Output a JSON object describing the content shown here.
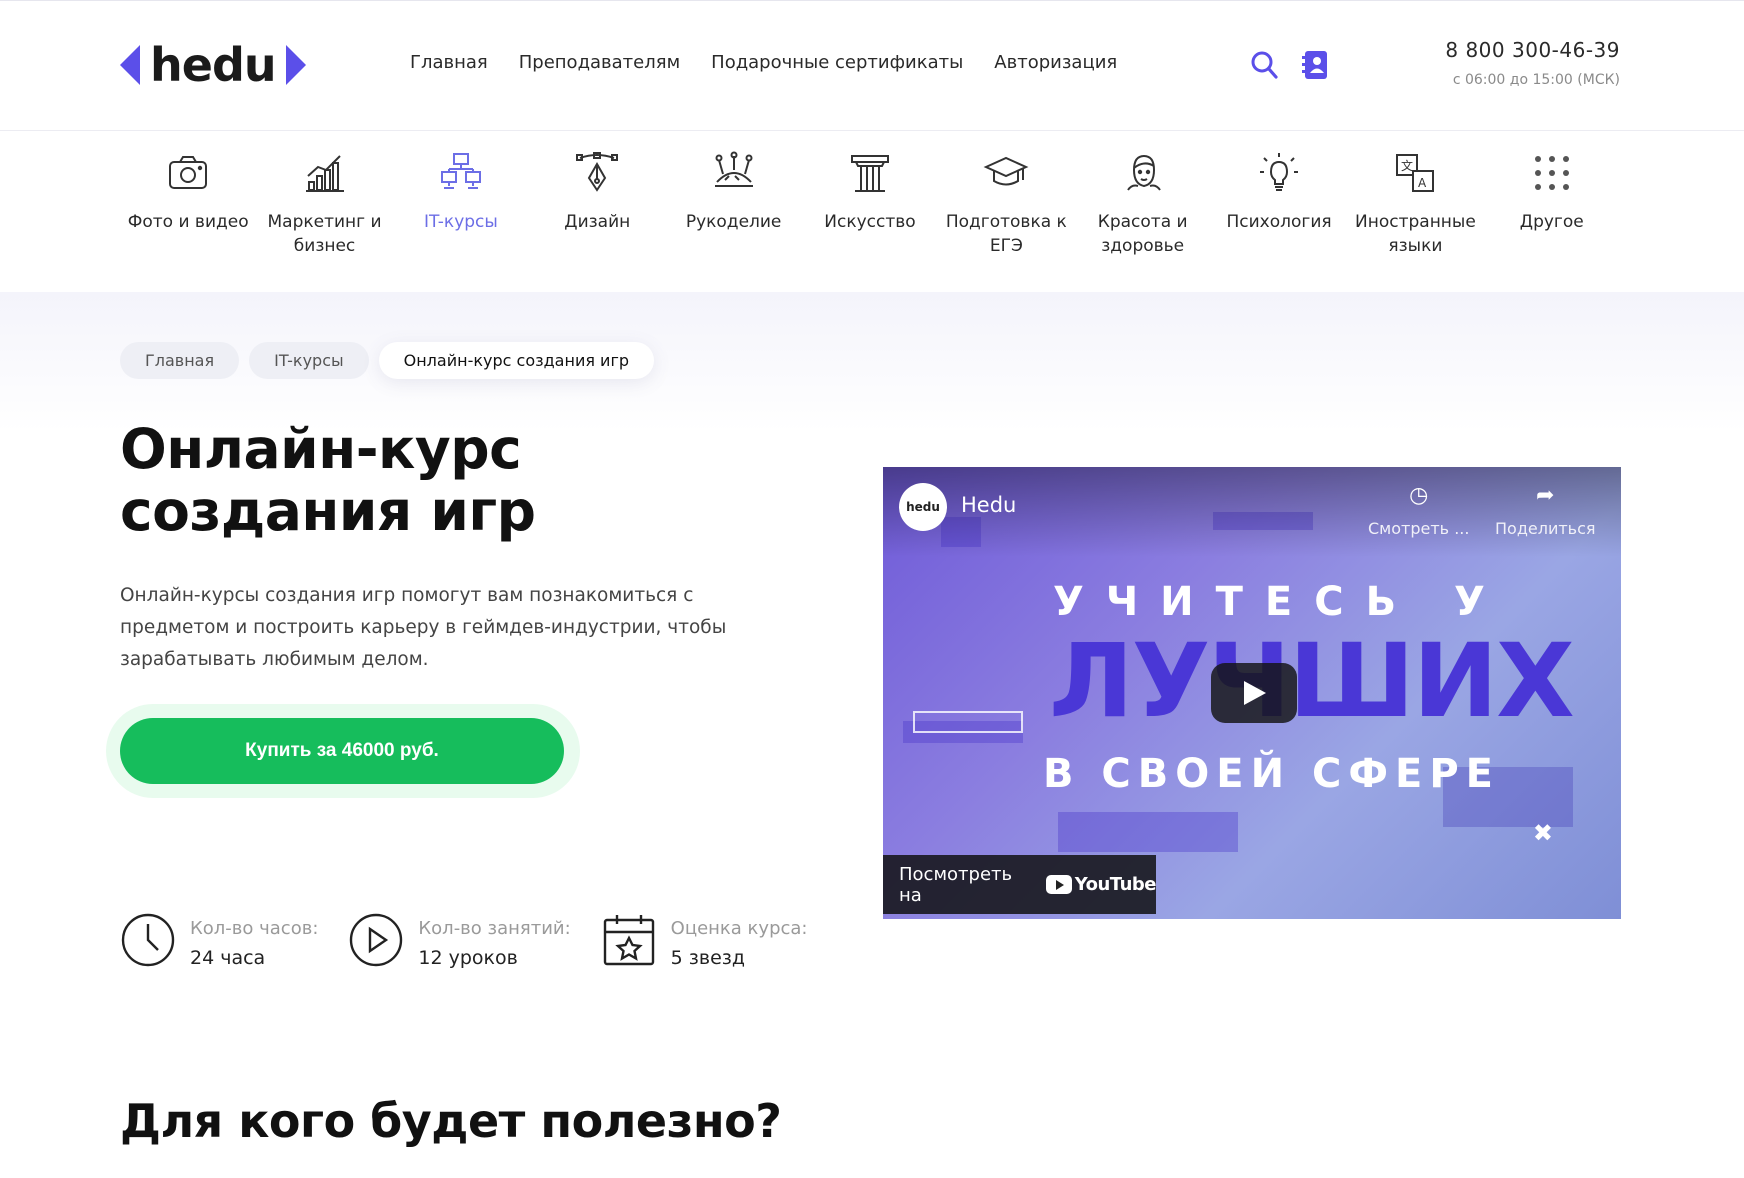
{
  "header": {
    "logo_text": "hedu",
    "nav": [
      "Главная",
      "Преподавателям",
      "Подарочные сертификаты",
      "Авторизация"
    ],
    "phone": "8 800 300-46-39",
    "hours": "с 06:00 до 15:00 (МСК)",
    "accent": "#5b4fe9"
  },
  "categories": [
    {
      "label": "Фото и видео",
      "icon": "camera-icon"
    },
    {
      "label": "Маркетинг и бизнес",
      "icon": "chart-icon"
    },
    {
      "label": "IT-курсы",
      "icon": "network-icon",
      "active": true
    },
    {
      "label": "Дизайн",
      "icon": "pen-tool-icon"
    },
    {
      "label": "Рукоделие",
      "icon": "pincushion-icon"
    },
    {
      "label": "Искусство",
      "icon": "column-icon"
    },
    {
      "label": "Подготовка к ЕГЭ",
      "icon": "graduation-cap-icon"
    },
    {
      "label": "Красота и здоровье",
      "icon": "face-icon"
    },
    {
      "label": "Психология",
      "icon": "lightbulb-icon"
    },
    {
      "label": "Иностранные языки",
      "icon": "translate-icon"
    },
    {
      "label": "Другое",
      "icon": "grid-dots-icon"
    }
  ],
  "breadcrumbs": [
    "Главная",
    "IT-курсы",
    "Онлайн-курс создания игр"
  ],
  "course": {
    "title": "Онлайн-курс создания игр",
    "description": "Онлайн-курсы создания игр помогут вам познакомиться с предметом и построить карьеру в геймдев-индустрии, чтобы зарабатывать любимым делом.",
    "buy_label": "Купить за 46000 руб.",
    "stats": [
      {
        "key": "Кол-во часов:",
        "value": "24 часа",
        "icon": "clock-icon"
      },
      {
        "key": "Кол-во занятий:",
        "value": "12 уроков",
        "icon": "play-circle-icon"
      },
      {
        "key": "Оценка курса:",
        "value": "5 звезд",
        "icon": "calendar-star-icon"
      }
    ]
  },
  "video": {
    "avatar_text": "hedu",
    "channel": "Hedu",
    "watch_later": "Смотреть ...",
    "share": "Поделиться",
    "line1": "УЧИТЕСЬ У",
    "line2": "ЛУЧШИХ",
    "line3": "В СВОЕЙ СФЕРЕ",
    "watch_on": "Посмотреть на",
    "youtube": "YouTube"
  },
  "section_title": "Для кого будет полезно?"
}
